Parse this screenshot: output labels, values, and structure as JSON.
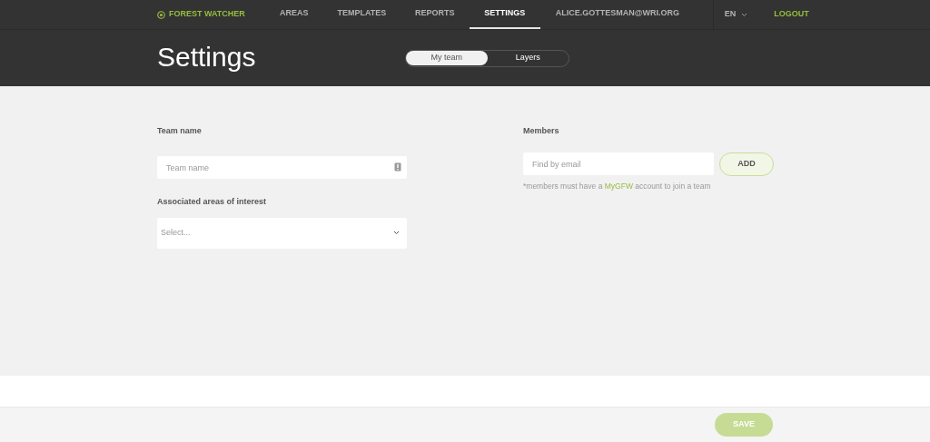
{
  "nav": {
    "brand": "FOREST WATCHER",
    "items": [
      {
        "label": "AREAS",
        "selected": false
      },
      {
        "label": "TEMPLATES",
        "selected": false
      },
      {
        "label": "REPORTS",
        "selected": false
      },
      {
        "label": "SETTINGS",
        "selected": true
      },
      {
        "label": "ALICE.GOTTESMAN@WRI.ORG",
        "selected": false
      }
    ],
    "language": "EN",
    "logout": "LOGOUT"
  },
  "header": {
    "title": "Settings",
    "tabs": [
      {
        "label": "My team",
        "selected": true
      },
      {
        "label": "Layers",
        "selected": false
      }
    ]
  },
  "team": {
    "name_label": "Team name",
    "name_placeholder": "Team name",
    "areas_label": "Associated areas of interest",
    "areas_placeholder": "Select..."
  },
  "members": {
    "label": "Members",
    "placeholder": "Find by email",
    "add_button": "ADD",
    "note_before": "*members must have a",
    "note_link": "MyGFW",
    "note_after": "account to join a team"
  },
  "footer": {
    "save_button": "SAVE",
    "disabled": true
  }
}
